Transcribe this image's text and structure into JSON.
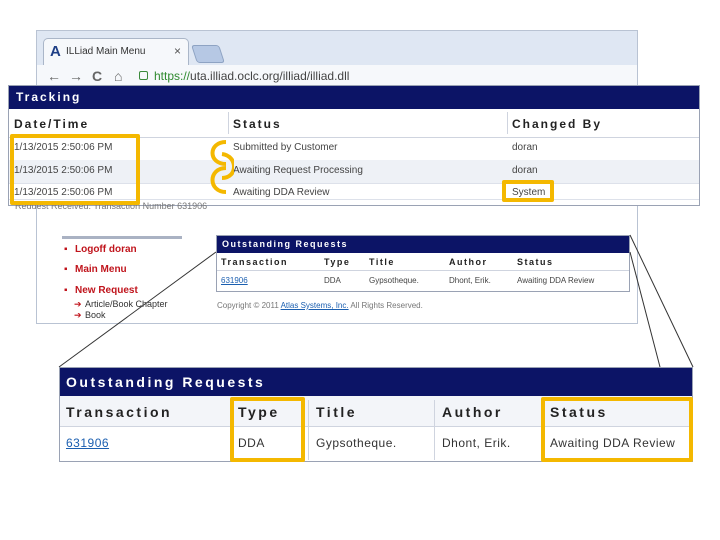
{
  "browser": {
    "tab_title": "ILLiad Main Menu",
    "tab_logo": "A",
    "tab_close": "×",
    "back": "←",
    "forward": "→",
    "reload": "C",
    "home": "⌂",
    "url_scheme": "https://",
    "url_rest": "uta.illiad.oclc.org/illiad/illiad.dll"
  },
  "tracking": {
    "title": "Tracking",
    "columns": [
      "Date/Time",
      "Status",
      "Changed By"
    ],
    "rows": [
      {
        "datetime": "1/13/2015 2:50:06 PM",
        "status": "Submitted by Customer",
        "changed_by": "doran"
      },
      {
        "datetime": "1/13/2015 2:50:06 PM",
        "status": "Awaiting Request Processing",
        "changed_by": "doran"
      },
      {
        "datetime": "1/13/2015 2:50:06 PM",
        "status": "Awaiting DDA Review",
        "changed_by": "System"
      }
    ],
    "partial_text": "Request Received. Transaction Number 631906"
  },
  "nav": {
    "items": [
      "Logoff doran",
      "Main Menu",
      "New Request"
    ],
    "subitems": [
      "Article/Book Chapter",
      "Book"
    ],
    "bullet": "▪",
    "arrow": "➔"
  },
  "outstanding_small": {
    "title": "Outstanding Requests",
    "columns": [
      "Transaction",
      "Type",
      "Title",
      "Author",
      "Status"
    ],
    "row": {
      "transaction": "631906",
      "type": "DDA",
      "title": "Gypsotheque.",
      "author": "Dhont, Erik.",
      "status": "Awaiting DDA Review"
    }
  },
  "copyright": {
    "prefix": "Copyright © 2011 ",
    "link": "Atlas Systems, Inc.",
    "suffix": " All Rights Reserved."
  },
  "outstanding_large": {
    "title": "Outstanding Requests",
    "columns": [
      "Transaction",
      "Type",
      "Title",
      "Author",
      "Status"
    ],
    "row": {
      "transaction": "631906",
      "type": "DDA",
      "title": "Gypsotheque.",
      "author": "Dhont, Erik.",
      "status": "Awaiting DDA Review"
    }
  },
  "colors": {
    "header_navy": "#0c1466",
    "highlight": "#f4b800",
    "nav_red": "#c0141c",
    "link_blue": "#1b5fb0"
  }
}
